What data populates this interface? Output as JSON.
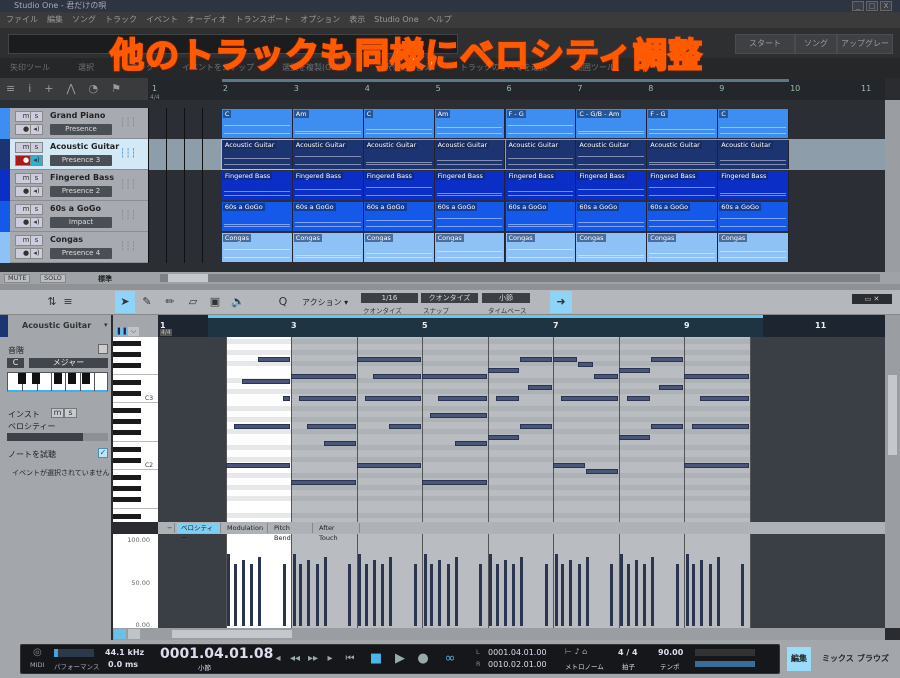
{
  "window": {
    "title": "Studio One - 君だけの唄",
    "controls": [
      "_",
      "□",
      "X"
    ]
  },
  "menu": [
    "ファイル",
    "編集",
    "ソング",
    "トラック",
    "イベント",
    "オーディオ",
    "トランスポート",
    "オプション",
    "表示",
    "Studio One",
    "ヘルプ"
  ],
  "toolbar": {
    "start": "スタート",
    "song": "ソング",
    "upgrade": "アップグレード"
  },
  "toolhints": [
    "矢印ツール",
    "選択",
    "トラック",
    "イベントをスナップ",
    "選択を複製(GB加)",
    "選択を切り替え",
    "トラックのすべてを選択",
    "範囲ツール"
  ],
  "overlay_caption": "他のトラックも同様にベロシティ調整",
  "arrange": {
    "ruler": [
      "1",
      "2",
      "3",
      "4",
      "5",
      "6",
      "7",
      "8",
      "9",
      "10",
      "11"
    ],
    "time_signature": "4/4",
    "tracks": [
      {
        "name": "Grand Piano",
        "instrument": "Presence",
        "color": "#3d8ef0",
        "clips": [
          "C",
          "Am",
          "C",
          "Am",
          "F - G",
          "C - G/B - Am",
          "F - G",
          "C"
        ]
      },
      {
        "name": "Acoustic Guitar",
        "instrument": "Presence 3",
        "color": "#1d3473",
        "selected": true,
        "clips": [
          "Acoustic Guitar",
          "Acoustic Guitar",
          "Acoustic Guitar",
          "Acoustic Guitar",
          "Acoustic Guitar",
          "Acoustic Guitar",
          "Acoustic Guitar",
          "Acoustic Guitar"
        ]
      },
      {
        "name": "Fingered Bass",
        "instrument": "Presence 2",
        "color": "#0b2fc6",
        "clips": [
          "Fingered Bass",
          "Fingered Bass",
          "Fingered Bass",
          "Fingered Bass",
          "Fingered Bass",
          "Fingered Bass",
          "Fingered Bass",
          "Fingered Bass"
        ]
      },
      {
        "name": "60s a GoGo",
        "instrument": "Impact",
        "color": "#1459ea",
        "clips": [
          "60s a GoGo",
          "60s a GoGo",
          "60s a GoGo",
          "60s a GoGo",
          "60s a GoGo",
          "60s a GoGo",
          "60s a GoGo",
          "60s a GoGo"
        ]
      },
      {
        "name": "Congas",
        "instrument": "Presence 4",
        "color": "#8ec2f6",
        "clips": [
          "Congas",
          "Congas",
          "Congas",
          "Congas",
          "Congas",
          "Congas",
          "Congas",
          "Congas"
        ]
      }
    ],
    "bottom": {
      "mute": "MUTE",
      "solo": "SOLO",
      "view": "標準"
    }
  },
  "editor": {
    "action": "アクション",
    "quantize": {
      "value": "1/16",
      "label": "クオンタイズ"
    },
    "snap": {
      "value": "クオンタイズ",
      "label": "スナップ"
    },
    "timebase": {
      "value": "小節",
      "label": "タイムベース"
    },
    "track": "Acoustic Guitar",
    "inspector": {
      "scale": "音階",
      "key": "C",
      "mode": "メジャー",
      "inst": "インスト",
      "m": "m",
      "s": "s",
      "velocity": "ベロシティー",
      "velocity_level": 0.75,
      "audition": "ノートを試聴",
      "no_event": "イベントが選択されていません"
    },
    "ruler": [
      "1",
      "3",
      "5",
      "7",
      "9",
      "11"
    ],
    "time_signature": "4/4",
    "piano_labels": [
      "C3",
      "C2"
    ],
    "tabs": [
      "−",
      "ベロシティー",
      "Modulation",
      "Pitch Bend",
      "After Touch"
    ],
    "vel_scale": [
      "100.00",
      "50.00",
      "0.00"
    ],
    "notes": [
      [
        2,
        2,
        2,
        67
      ],
      [
        2,
        1,
        3,
        63
      ],
      [
        2,
        3.5,
        0.5,
        60
      ],
      [
        2,
        0.5,
        3.5,
        55
      ],
      [
        2,
        0,
        4,
        48
      ],
      [
        3,
        0,
        4,
        64
      ],
      [
        3,
        0.5,
        3.5,
        60
      ],
      [
        3,
        1,
        3,
        55
      ],
      [
        3,
        2,
        2,
        52
      ],
      [
        3,
        0,
        4,
        45
      ],
      [
        4,
        0,
        4,
        67
      ],
      [
        4,
        1,
        3,
        64
      ],
      [
        4,
        0.5,
        3.5,
        60
      ],
      [
        4,
        2,
        2,
        55
      ],
      [
        4,
        0,
        4,
        48
      ],
      [
        5,
        0,
        4,
        64
      ],
      [
        5,
        1,
        3,
        60
      ],
      [
        5,
        0.5,
        3.5,
        57
      ],
      [
        5,
        2,
        2,
        52
      ],
      [
        5,
        0,
        4,
        45
      ],
      [
        6,
        0,
        2,
        65
      ],
      [
        6,
        2,
        2,
        67
      ],
      [
        6,
        0.5,
        1.5,
        60
      ],
      [
        6,
        2.5,
        1.5,
        62
      ],
      [
        6,
        0,
        2,
        53
      ],
      [
        6,
        2,
        2,
        55
      ],
      [
        7,
        0,
        1.5,
        67
      ],
      [
        7,
        1.5,
        1,
        66
      ],
      [
        7,
        2.5,
        1.5,
        64
      ],
      [
        7,
        0.5,
        3.5,
        60
      ],
      [
        7,
        0,
        2,
        48
      ],
      [
        7,
        2,
        2,
        47
      ],
      [
        8,
        0,
        2,
        65
      ],
      [
        8,
        2,
        2,
        67
      ],
      [
        8,
        0.5,
        1.5,
        60
      ],
      [
        8,
        2.5,
        1.5,
        62
      ],
      [
        8,
        0,
        2,
        53
      ],
      [
        8,
        2,
        2,
        55
      ],
      [
        9,
        0,
        4,
        64
      ],
      [
        9,
        1,
        3,
        60
      ],
      [
        9,
        0.5,
        3.5,
        55
      ],
      [
        9,
        0,
        4,
        48
      ]
    ],
    "velocities": [
      [
        0.1,
        82
      ],
      [
        0.5,
        70
      ],
      [
        1,
        75
      ],
      [
        1.5,
        70
      ],
      [
        2,
        78
      ],
      [
        3.5,
        70
      ]
    ],
    "velocity_bars": [
      2,
      3,
      4,
      5,
      6,
      7,
      8,
      9
    ]
  },
  "transport": {
    "midi": "MIDI",
    "performance": "パフォーマンス",
    "rate": "44.1 kHz",
    "latency": "0.0 ms",
    "position": "0001.04.01.08",
    "position_unit": "小節",
    "L": "L",
    "R": "R",
    "left_locator": "0001.04.01.00",
    "right_locator": "0010.02.01.00",
    "metronome": "メトロノーム",
    "signature": "4 / 4",
    "signature_label": "拍子",
    "tempo": "90.00",
    "tempo_label": "テンポ"
  },
  "views": [
    "編集",
    "ミックス",
    "ブラウズ"
  ]
}
